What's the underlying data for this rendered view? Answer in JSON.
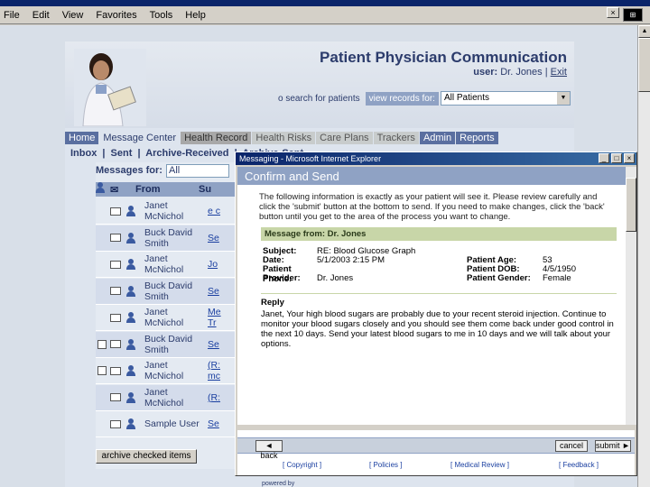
{
  "browser": {
    "menu": [
      "File",
      "Edit",
      "View",
      "Favorites",
      "Tools",
      "Help"
    ],
    "close_glyph": "×"
  },
  "app": {
    "title": "Patient Physician Communication",
    "user_label": "user:",
    "user_name": "Dr. Jones",
    "exit": "Exit",
    "search_link": "o search for patients",
    "view_records_label": "view records for:",
    "view_records_value": "All Patients"
  },
  "tabs": [
    {
      "label": "Home",
      "active": true
    },
    {
      "label": "Message Center",
      "active": false
    },
    {
      "label": "Health Record",
      "active": false
    },
    {
      "label": "Health Risks",
      "active": false
    },
    {
      "label": "Care Plans",
      "active": false
    },
    {
      "label": "Trackers",
      "active": false
    },
    {
      "label": "Admin",
      "active": false
    },
    {
      "label": "Reports",
      "active": false
    }
  ],
  "subtabs": [
    "Inbox",
    "|",
    "Sent",
    "|",
    "Archive-Received",
    "|",
    "Archive-Sent"
  ],
  "messages": {
    "for_label": "Messages for:",
    "for_value": "All",
    "col_from": "From",
    "col_subject": "Su",
    "archive_button": "archive checked items",
    "rows": [
      {
        "from": "Janet McNichol",
        "subject": "e c",
        "checkbox": false
      },
      {
        "from": "Buck David Smith",
        "subject": "Se",
        "checkbox": false
      },
      {
        "from": "Janet McNichol",
        "subject": "Jo",
        "checkbox": false
      },
      {
        "from": "Buck David Smith",
        "subject": "Se",
        "checkbox": false
      },
      {
        "from": "Janet McNichol",
        "subject": "Me Tr",
        "checkbox": false
      },
      {
        "from": "Buck David Smith",
        "subject": "Se",
        "checkbox": true
      },
      {
        "from": "Janet McNichol",
        "subject": "(R: mc",
        "checkbox": true
      },
      {
        "from": "Janet McNichol",
        "subject": "(R:",
        "checkbox": false
      },
      {
        "from": "Sample User",
        "subject": "Se",
        "checkbox": false
      }
    ],
    "powered": "powered by"
  },
  "popup": {
    "window_title": "Messaging - Microsoft Internet Explorer",
    "heading": "Confirm and Send",
    "intro": "The following information is exactly as your patient will see it. Please review carefully and click the 'submit' button at the bottom to send. If you need to make changes, click the 'back' button until you get to the area of the process you want to change.",
    "section_head": "Message from: Dr. Jones",
    "fields": {
      "subject_label": "Subject:",
      "subject_value": "RE: Blood Glucose Graph",
      "date_label": "Date:",
      "date_value": "5/1/2003 2:15 PM",
      "phone_label": "Patient Phone:",
      "phone_value": "",
      "provider_label": "Provider:",
      "provider_value": "Dr. Jones",
      "age_label": "Patient Age:",
      "age_value": "53",
      "dob_label": "Patient DOB:",
      "dob_value": "4/5/1950",
      "gender_label": "Patient Gender:",
      "gender_value": "Female"
    },
    "reply_label": "Reply",
    "reply_body": "Janet, Your high blood sugars are probably due to your recent steroid injection. Continue to monitor your blood sugars closely and you should see them come back under good control in the next 10 days. Send your latest blood sugars to me in 10 days and we will talk about your options.",
    "back_button": "back",
    "cancel_button": "cancel",
    "submit_button": "submit",
    "links": [
      "[ Copyright ]",
      "[ Policies ]",
      "[ Medical Review ]",
      "[ Feedback ]"
    ]
  }
}
